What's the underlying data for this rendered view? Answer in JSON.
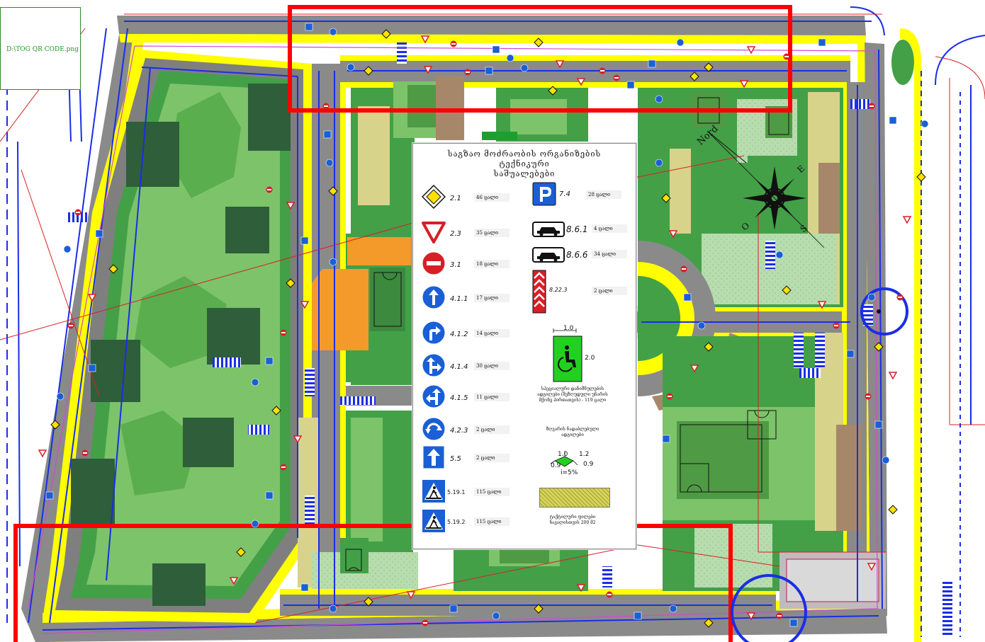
{
  "qr_caption": "D:\\TOG QR CODE.png",
  "compass": {
    "north": "Nord",
    "east": "E",
    "south": "S",
    "west": "O"
  },
  "legend": {
    "title_line1": "საგზაო მოძრაობის ორგანიზების ტექნიკური",
    "title_line2": "საშუალებები",
    "signs_left": [
      {
        "code": "2.1",
        "qty": "46 ცალი",
        "icon": "priority-road-icon"
      },
      {
        "code": "2.3",
        "qty": "35 ცალი",
        "icon": "give-way-icon"
      },
      {
        "code": "3.1",
        "qty": "18 ცალი",
        "icon": "no-entry-icon"
      },
      {
        "code": "4.1.1",
        "qty": "17 ცალი",
        "icon": "straight-ahead-icon"
      },
      {
        "code": "4.1.2",
        "qty": "14 ცალი",
        "icon": "turn-right-icon"
      },
      {
        "code": "4.1.4",
        "qty": "30 ცალი",
        "icon": "straight-or-right-icon"
      },
      {
        "code": "4.1.5",
        "qty": "11 ცალი",
        "icon": "straight-or-left-icon"
      },
      {
        "code": "4.2.3",
        "qty": "2 ცალი",
        "icon": "roundabout-icon"
      },
      {
        "code": "5.5",
        "qty": "2 ცალი",
        "icon": "one-way-icon"
      },
      {
        "code": "5.19.1",
        "qty": "115 ცალი",
        "icon": "pedestrian-crossing-icon"
      },
      {
        "code": "5.19.2",
        "qty": "115 ცალი",
        "icon": "pedestrian-crossing-icon"
      }
    ],
    "signs_right": [
      {
        "code": "7.4",
        "qty": "28 ცალი",
        "icon": "parking-icon"
      },
      {
        "code": "8.6.1",
        "qty": "4 ცალი",
        "icon": "car-plate-icon"
      },
      {
        "code": "8.6.6",
        "qty": "34 ცალი",
        "icon": "car-plate-icon"
      },
      {
        "code": "8.22.3",
        "qty": "2 ცალი",
        "icon": "chevron-marker-icon"
      }
    ],
    "disabled_parking": {
      "width_label": "1.0",
      "height_label": "2.0",
      "note_line1": "სპეციალური დანიშნულების",
      "note_line2": "ადგილები (შეზღუდული უნარის",
      "note_line3": "მქონე პირთათვის) - 119 ცალი"
    },
    "ramp": {
      "note_line1": "ზღვარის ჩადაბლებული",
      "note_line2": "ადგილები",
      "top_left": "1.0",
      "top_right": "1.2",
      "side_left": "0.9",
      "side_right": "0.9",
      "slope": "i=5%"
    },
    "paving": {
      "note_line1": "ტაქტილური ფილები",
      "note_line2": "ნავალისთვის 200 მ2"
    }
  },
  "colors": {
    "road": "#7f7f7f",
    "curb": "#ffff00",
    "grass": "#43a047",
    "lawn": "#6cbf5c",
    "building": "#2f5e3a",
    "orange": "#f39a2a",
    "frame_red": "#ff0000",
    "markings": "#1a2ee6",
    "sign_blue": "#1a5fd6",
    "sign_red": "#d81f26"
  }
}
